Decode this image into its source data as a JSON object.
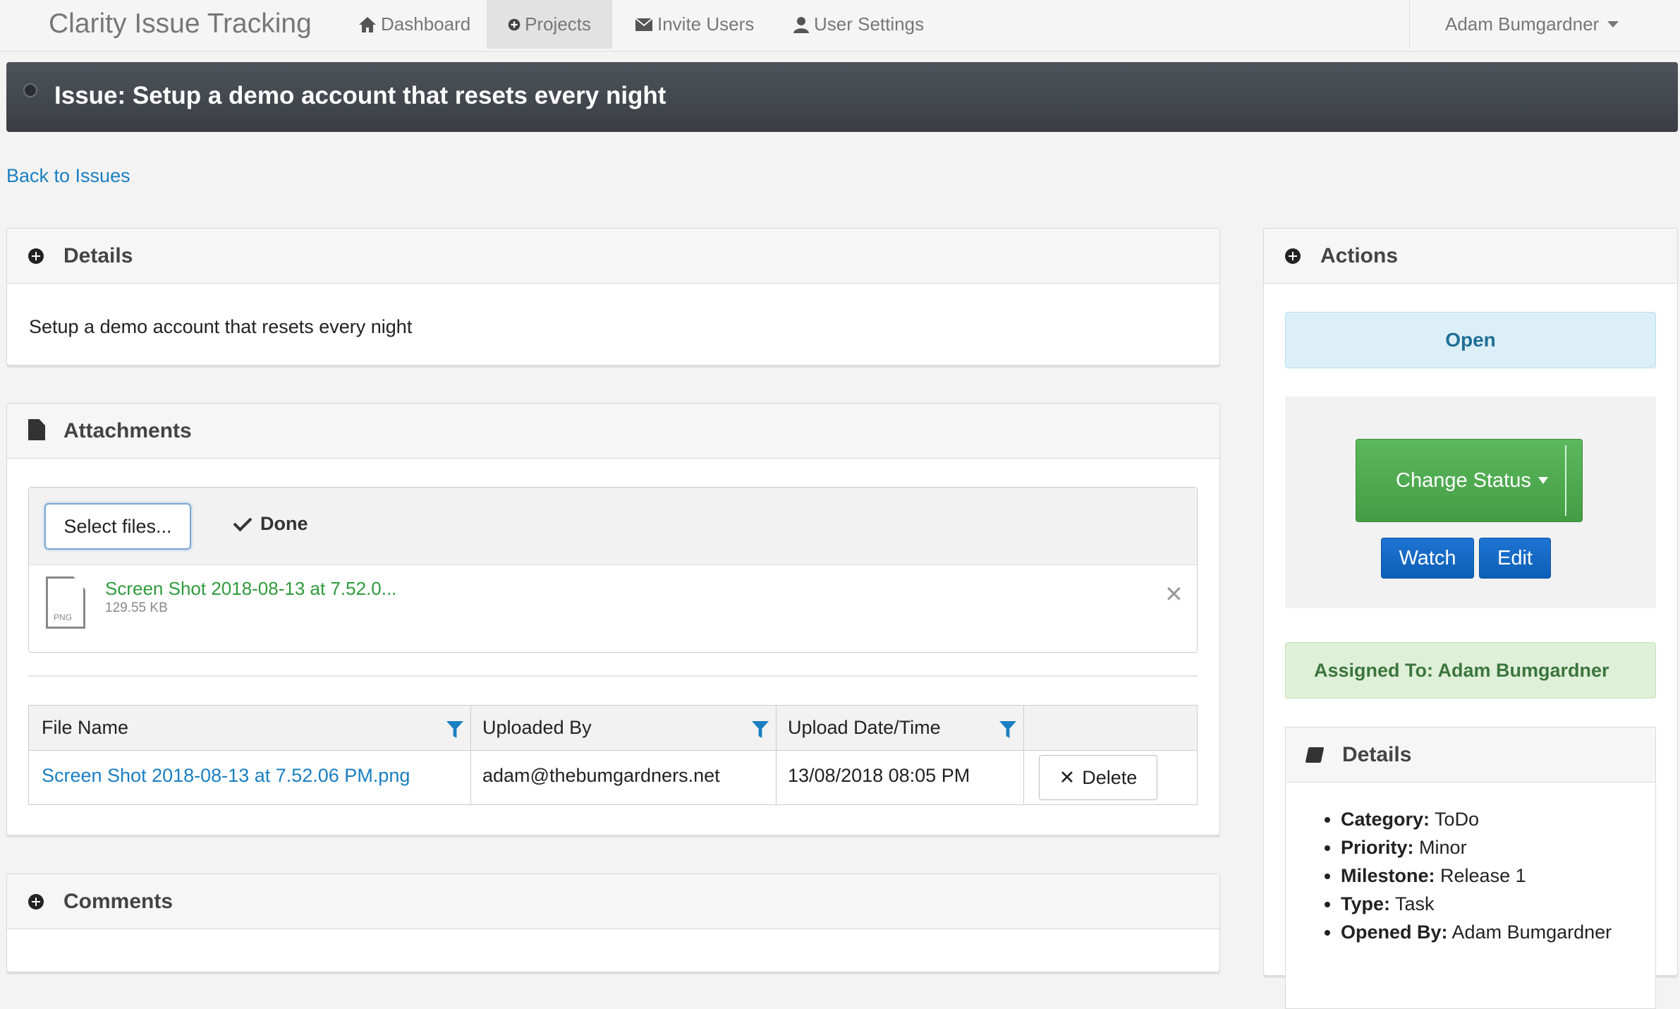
{
  "nav": {
    "brand": "Clarity Issue Tracking",
    "items": [
      {
        "label": "Dashboard",
        "icon": "home-icon",
        "active": false
      },
      {
        "label": "Projects",
        "icon": "plus-circle-icon",
        "active": true
      },
      {
        "label": "Invite Users",
        "icon": "envelope-icon",
        "active": false
      },
      {
        "label": "User Settings",
        "icon": "user-icon",
        "active": false
      }
    ],
    "user": "Adam Bumgardner"
  },
  "issue": {
    "title": "Issue: Setup a demo account that resets every night",
    "back_link": "Back to Issues"
  },
  "details_panel": {
    "title": "Details",
    "description": "Setup a demo account that resets every night"
  },
  "attachments_panel": {
    "title": "Attachments",
    "select_button": "Select files...",
    "done_label": "Done",
    "upload": {
      "file_name": "Screen Shot 2018-08-13 at 7.52.0...",
      "file_size": "129.55 KB",
      "file_type": "PNG"
    },
    "table": {
      "columns": [
        "File Name",
        "Uploaded By",
        "Upload Date/Time"
      ],
      "rows": [
        {
          "file_name": "Screen Shot 2018-08-13 at 7.52.06 PM.png",
          "uploaded_by": "adam@thebumgardners.net",
          "uploaded_at": "13/08/2018 08:05 PM",
          "delete_label": "Delete"
        }
      ]
    }
  },
  "comments_panel": {
    "title": "Comments"
  },
  "actions_panel": {
    "title": "Actions",
    "status": "Open",
    "change_status": "Change Status",
    "watch": "Watch",
    "edit": "Edit",
    "assigned": "Assigned To: Adam Bumgardner",
    "details_title": "Details",
    "details": [
      {
        "key": "Category:",
        "value": "ToDo"
      },
      {
        "key": "Priority:",
        "value": "Minor"
      },
      {
        "key": "Milestone:",
        "value": "Release 1"
      },
      {
        "key": "Type:",
        "value": "Task"
      },
      {
        "key": "Opened By:",
        "value": "Adam Bumgardner"
      }
    ]
  },
  "colors": {
    "link": "#1a7fc1",
    "banner": "#3f4349",
    "success": "#5cb85c",
    "primary": "#0d5fb6",
    "info_bg": "#dceff8",
    "assigned_bg": "#dff0d8"
  }
}
